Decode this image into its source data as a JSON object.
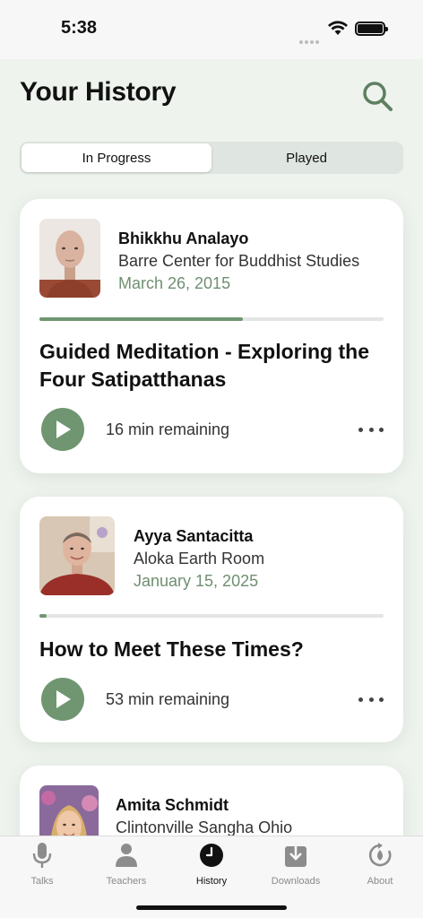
{
  "status": {
    "time": "5:38"
  },
  "header": {
    "title": "Your History"
  },
  "tabs": [
    {
      "label": "In Progress",
      "active": true
    },
    {
      "label": "Played",
      "active": false
    }
  ],
  "cards": [
    {
      "teacher": "Bhikkhu Analayo",
      "venue": "Barre Center for Buddhist Studies",
      "date": "March 26, 2015",
      "progress": 0.59,
      "title": "Guided Meditation - Exploring the Four Satipatthanas",
      "remaining": "16 min remaining"
    },
    {
      "teacher": "Ayya Santacitta",
      "venue": "Aloka Earth Room",
      "date": "January 15, 2025",
      "progress": 0.02,
      "title": "How to Meet These Times?",
      "remaining": "53 min remaining"
    },
    {
      "teacher": "Amita Schmidt",
      "venue": "Clintonville Sangha Ohio"
    }
  ],
  "tab_bar": [
    {
      "label": "Talks",
      "icon": "microphone-icon",
      "active": false
    },
    {
      "label": "Teachers",
      "icon": "person-icon",
      "active": false
    },
    {
      "label": "History",
      "icon": "clock-icon",
      "active": true
    },
    {
      "label": "Downloads",
      "icon": "download-icon",
      "active": false
    },
    {
      "label": "About",
      "icon": "about-icon",
      "active": false
    }
  ],
  "colors": {
    "accent": "#6f9670",
    "background": "#eef3ee",
    "date": "#6f8f70"
  }
}
